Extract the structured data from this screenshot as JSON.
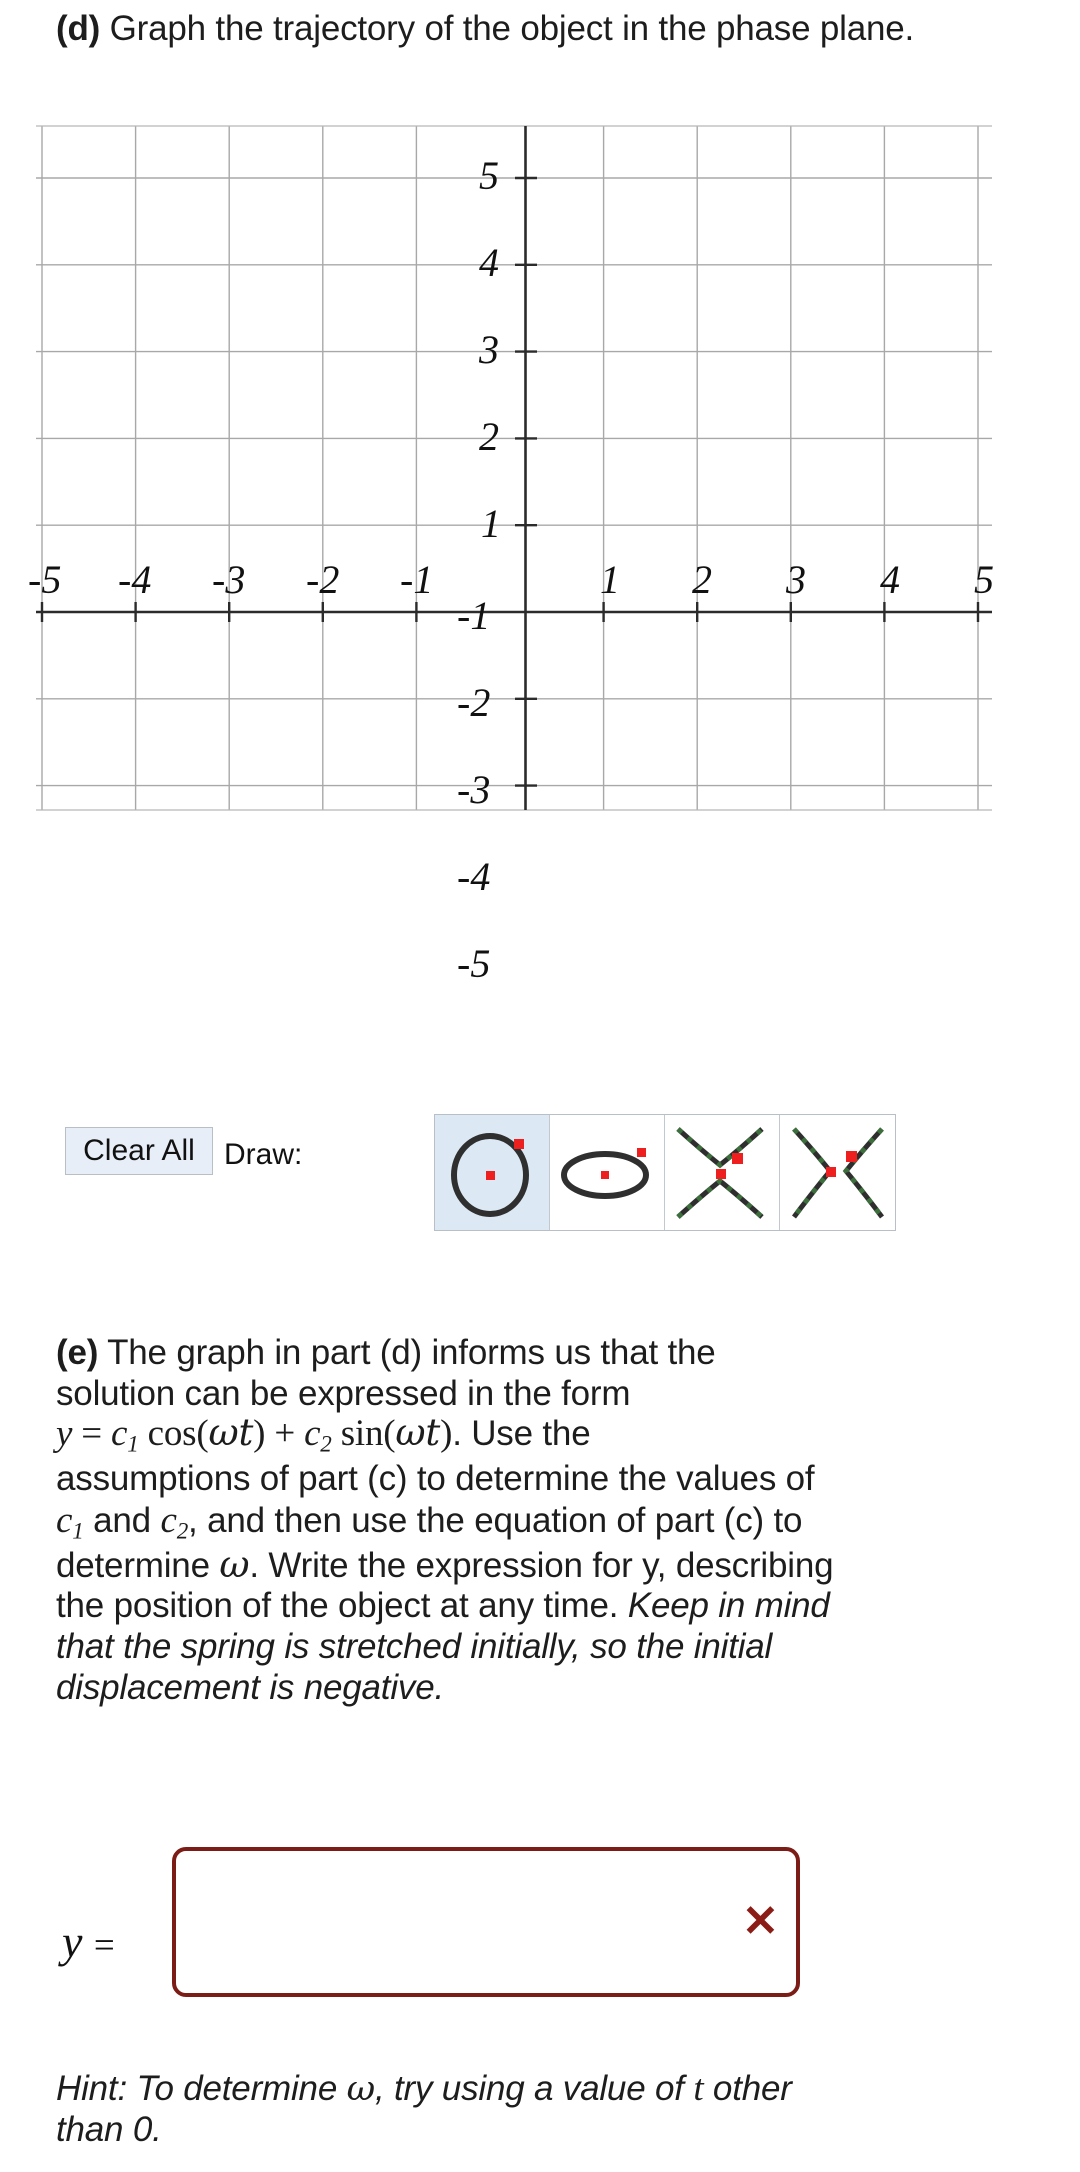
{
  "parts": {
    "d": {
      "marker": "(d)",
      "text": " Graph the trajectory of the object in the phase plane."
    },
    "e": {
      "marker": "(e)",
      "line1": " The graph in part (d) informs us that the",
      "line2": "solution can be expressed in the form",
      "formula_y": "y",
      "formula_eq": " = ",
      "formula_c1": "c",
      "formula_c1sub": "1",
      "formula_cos": " cos(",
      "formula_wt1": "ωt",
      "formula_close1": ")",
      "formula_plus": " + ",
      "formula_c2": "c",
      "formula_c2sub": "2",
      "formula_sin": " sin(",
      "formula_wt2": "ωt",
      "formula_close2": ")",
      "after_formula": ". Use the",
      "line4": "assumptions of part (c) to determine the values of",
      "line5_c1": "c",
      "line5_c1sub": "1",
      "line5_and": " and ",
      "line5_c2": "c",
      "line5_c2sub": "2",
      "line5_rest": ", and then use the equation of part (c) to",
      "line6_a": "determine ",
      "line6_omega": "ω",
      "line6_b": ". Write the expression for y, describing",
      "line7": "the position of the object at any time. ",
      "line7_italic": "Keep in mind",
      "line8_italic": "that the spring is stretched initially, so the initial",
      "line9_italic": "displacement is negative."
    }
  },
  "hint": {
    "lead": "Hint: To determine ",
    "omega": "ω",
    "rest": ", try using a value of ",
    "t": "t",
    "tail": " other",
    "line2": "than 0."
  },
  "toolbar": {
    "clear_all_label": "Clear All",
    "draw_label": "Draw:",
    "tools": [
      {
        "name": "circle-tool",
        "icon": "circle-with-point",
        "selected": true
      },
      {
        "name": "ellipse-tool",
        "icon": "ellipse-with-point",
        "selected": false
      },
      {
        "name": "hyperbola-vertical-tool",
        "icon": "hyperbola-opening-vertical",
        "selected": false
      },
      {
        "name": "hyperbola-horizontal-tool",
        "icon": "hyperbola-opening-horizontal",
        "selected": false
      }
    ],
    "selected_color": "#dce9f5",
    "button_bg": "#e8eef7"
  },
  "answer": {
    "label_y": "y",
    "label_eq": "=",
    "value": "",
    "placeholder": "",
    "clear_icon": "✕",
    "border_color": "#7b1c16",
    "icon_color": "#8c1d16"
  },
  "chart_data": {
    "type": "scatter",
    "title": "",
    "xlabel": "",
    "ylabel": "",
    "xlim": [
      -5.5,
      5.5
    ],
    "ylim": [
      -5.5,
      5.5
    ],
    "x_ticks": [
      -5,
      -4,
      -3,
      -2,
      -1,
      1,
      2,
      3,
      4,
      5
    ],
    "y_ticks": [
      5,
      4,
      3,
      2,
      1,
      -1,
      -2,
      -3,
      -4,
      -5
    ],
    "x_tick_labels": [
      "-5",
      "-4",
      "-3",
      "-2",
      "-1",
      "1",
      "2",
      "3",
      "4",
      "5"
    ],
    "y_tick_labels": [
      "5",
      "4",
      "3",
      "2",
      "1",
      "-1",
      "-2",
      "-3",
      "-4",
      "-5"
    ],
    "grid": true,
    "grid_color": "#9a9a9a",
    "axis_color": "#2b2b2b",
    "legend": "none",
    "series": [],
    "note": "Empty phase-plane grid; no trajectory drawn yet."
  }
}
